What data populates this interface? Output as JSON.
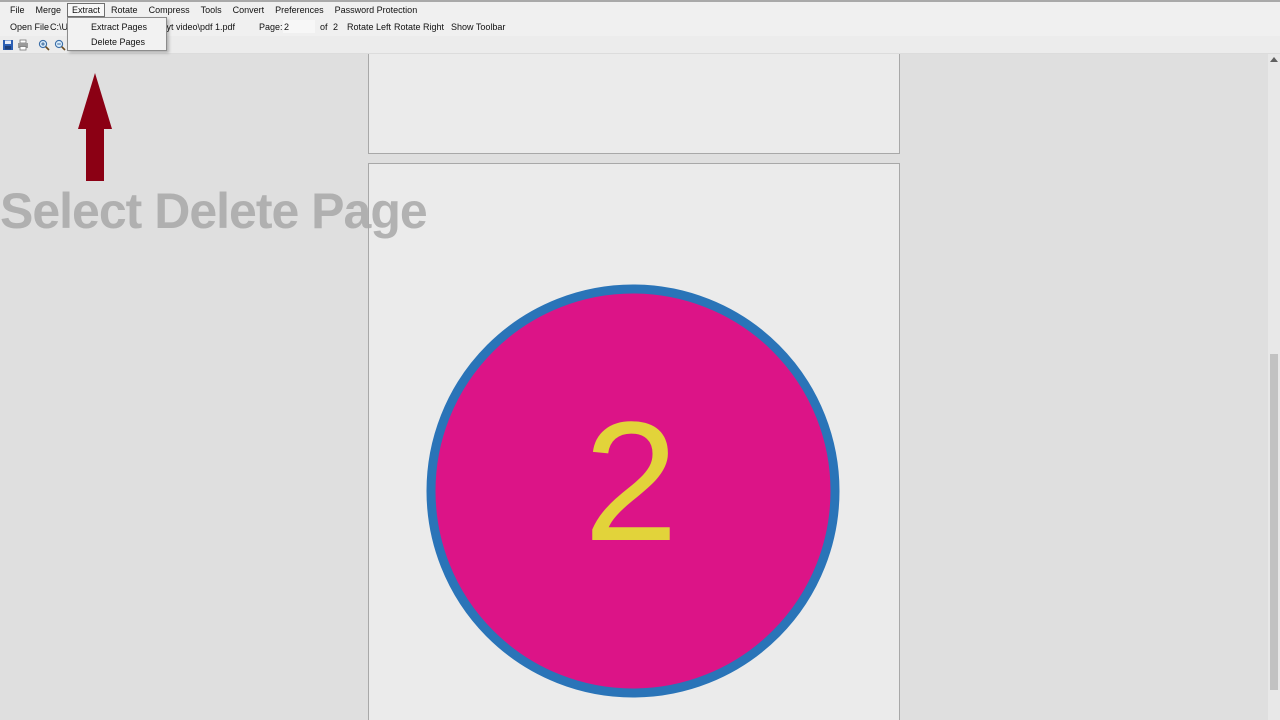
{
  "menubar": {
    "items": [
      "File",
      "Merge",
      "Extract",
      "Rotate",
      "Compress",
      "Tools",
      "Convert",
      "Preferences",
      "Password Protection"
    ],
    "active": "Extract"
  },
  "toolbar": {
    "open_file_label": "Open File",
    "path_visible_start": "C:\\U",
    "path_visible_end": "b\\yt video\\pdf 1.pdf",
    "page_label": "Page:",
    "page_value": "2",
    "of_label": "of",
    "total_pages": "2",
    "rotate_left_label": "Rotate Left",
    "rotate_right_label": "Rotate Right",
    "show_toolbar_label": "Show Toolbar"
  },
  "toolbar_icons": [
    "save-icon",
    "print-icon",
    "zoom-in-icon",
    "zoom-out-icon"
  ],
  "extract_menu": {
    "items": [
      "Extract Pages",
      "Delete Pages"
    ]
  },
  "annotation": {
    "caption": "Select Delete Page",
    "arrow_color": "#8b0014"
  },
  "document": {
    "page_number_text": "2",
    "circle_fill": "#dc1487",
    "circle_stroke": "#2a74b8",
    "digit_color": "#e2d33a",
    "page_bg": "#ebebeb"
  }
}
